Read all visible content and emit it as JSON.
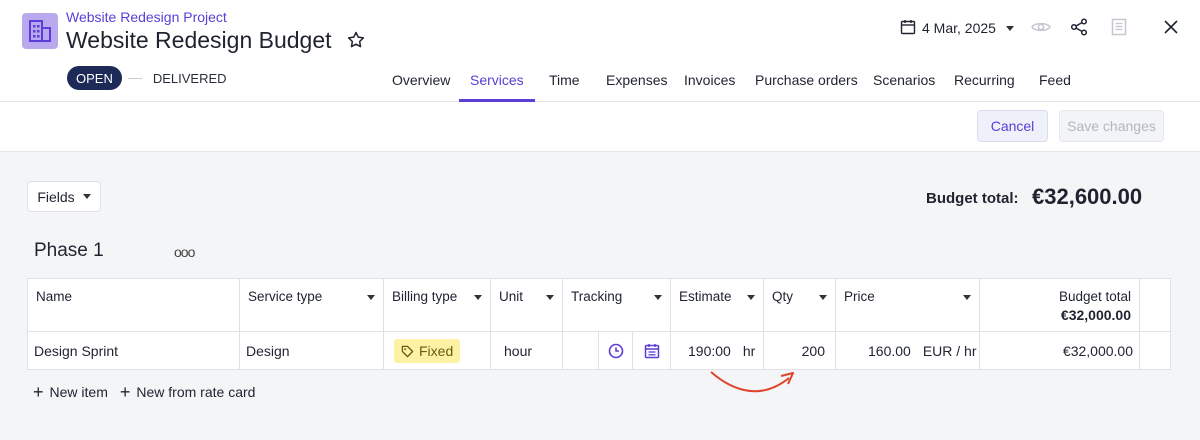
{
  "header": {
    "breadcrumb": "Website Redesign Project",
    "title": "Website Redesign Budget",
    "date": "4 Mar, 2025"
  },
  "status": {
    "current": "OPEN",
    "next": "DELIVERED"
  },
  "tabs": [
    {
      "label": "Overview",
      "active": false
    },
    {
      "label": "Services",
      "active": true
    },
    {
      "label": "Time",
      "active": false
    },
    {
      "label": "Expenses",
      "active": false
    },
    {
      "label": "Invoices",
      "active": false
    },
    {
      "label": "Purchase orders",
      "active": false
    },
    {
      "label": "Scenarios",
      "active": false
    },
    {
      "label": "Recurring",
      "active": false
    },
    {
      "label": "Feed",
      "active": false
    }
  ],
  "actions": {
    "cancel": "Cancel",
    "save": "Save changes"
  },
  "toolbar": {
    "fields": "Fields",
    "budget_total_label": "Budget total:",
    "budget_total_value": "€32,600.00"
  },
  "phase": {
    "title": "Phase 1",
    "menu": "ooo"
  },
  "table": {
    "columns": {
      "name": "Name",
      "service_type": "Service type",
      "billing_type": "Billing type",
      "unit": "Unit",
      "tracking": "Tracking",
      "estimate": "Estimate",
      "qty": "Qty",
      "price": "Price",
      "budget_total": "Budget total",
      "budget_total_sum": "€32,000.00"
    },
    "rows": [
      {
        "name": "Design Sprint",
        "service_type": "Design",
        "billing_type": "Fixed",
        "unit": "hour",
        "estimate": "190:00",
        "estimate_unit": "hr",
        "qty": "200",
        "price": "160.00",
        "price_unit": "EUR / hr",
        "budget_total": "€32,000.00"
      }
    ]
  },
  "links": {
    "new_item": "New item",
    "new_from_rate_card": "New from rate card"
  },
  "colors": {
    "accent": "#5b3ed6",
    "status_pill": "#1d2a57",
    "badge": "#fdf2a4",
    "arrow": "#e0452b"
  }
}
